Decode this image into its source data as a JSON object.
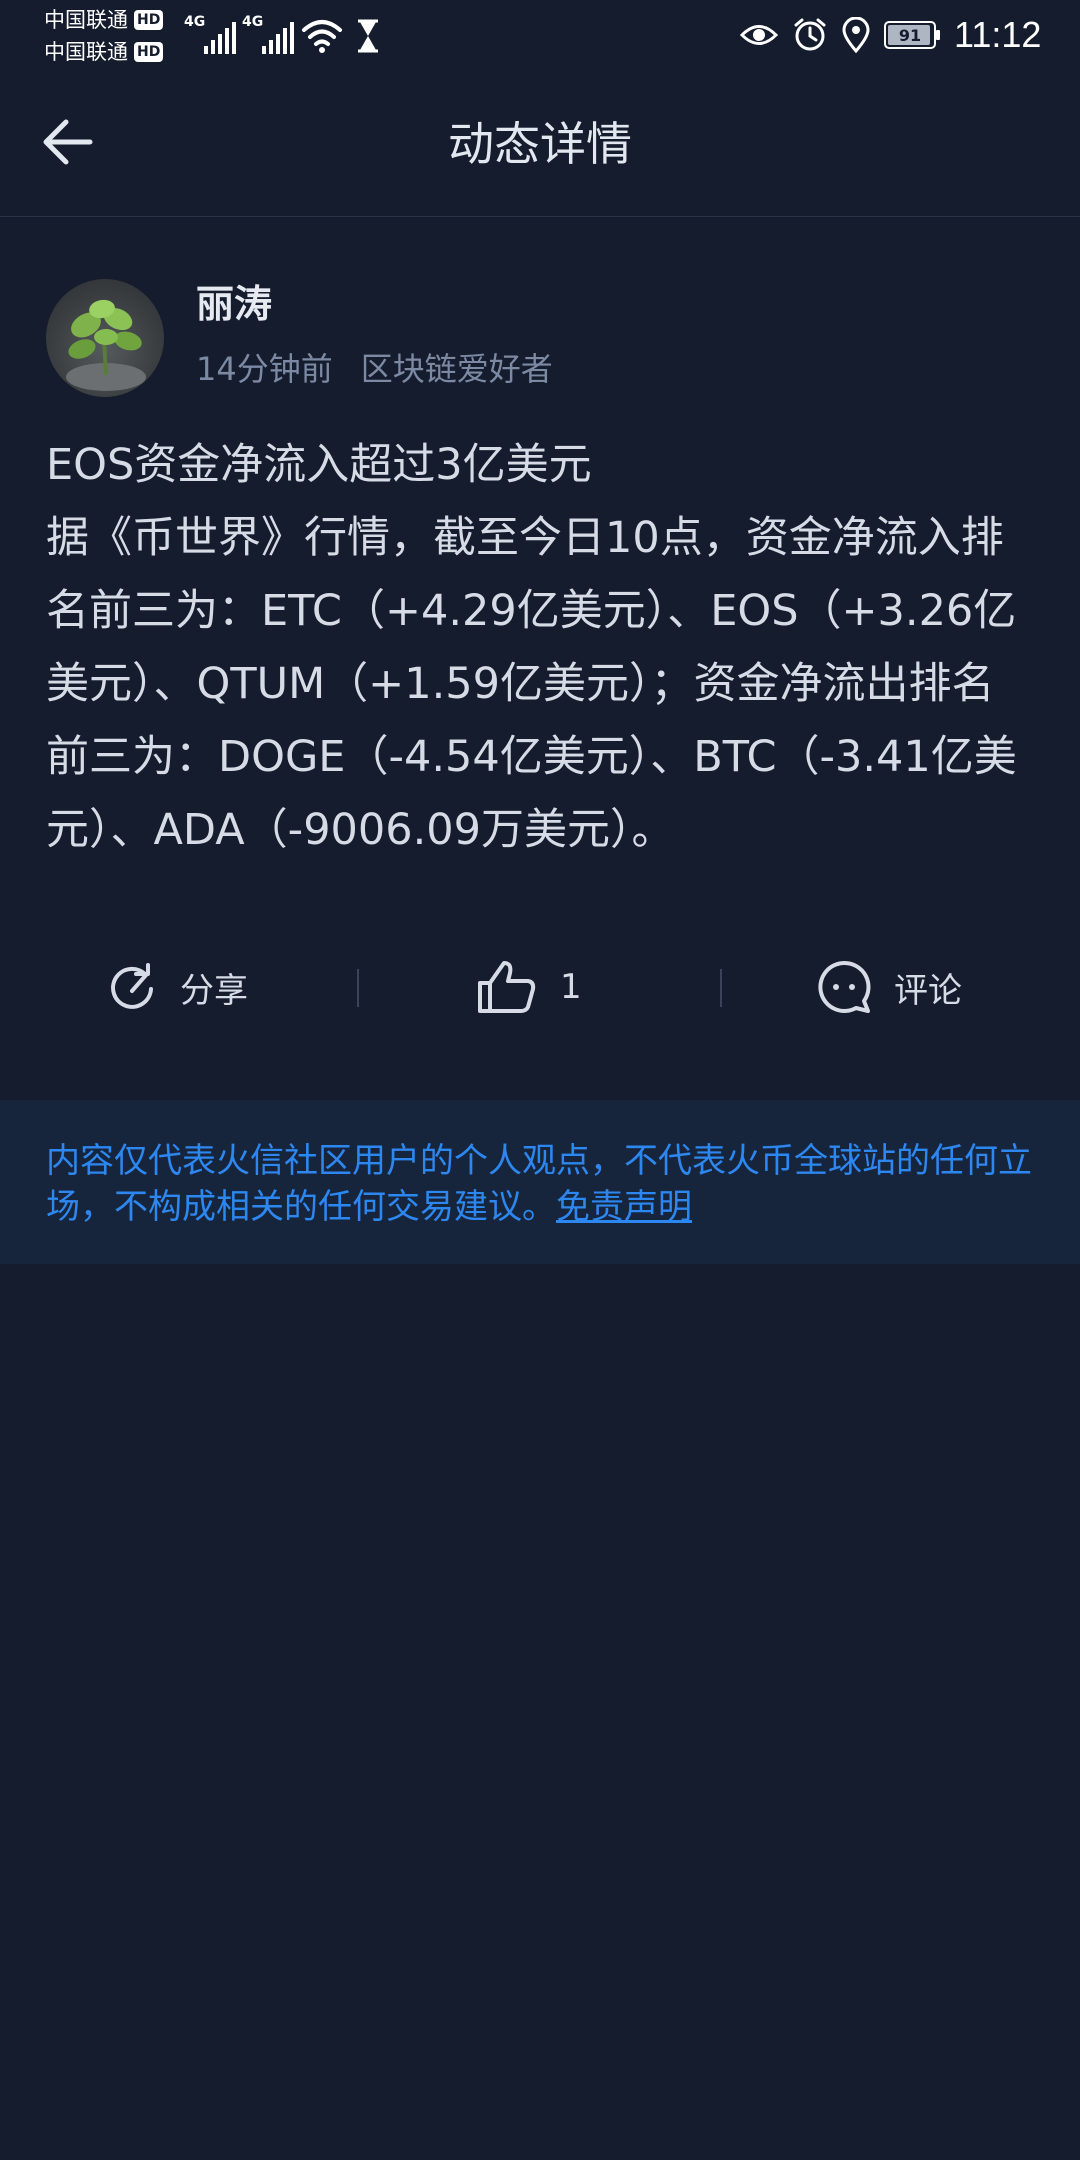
{
  "status_bar": {
    "carrier_1": "中国联通",
    "carrier_2": "中国联通",
    "hd_badge": "HD",
    "network_1": "4G",
    "network_2": "4G",
    "battery_level": "91",
    "time": "11:12"
  },
  "nav": {
    "title": "动态详情",
    "back_icon": "arrow-left-icon"
  },
  "post": {
    "author": "丽涛",
    "time_ago": "14分钟前",
    "tag": "区块链爱好者",
    "title": "EOS资金净流入超过3亿美元",
    "body": "据《币世界》行情，截至今日10点，资金净流入排名前三为：ETC（+4.29亿美元）、EOS（+3.26亿美元）、QTUM（+1.59亿美元）；资金净流出排名前三为：DOGE（-4.54亿美元）、BTC（-3.41亿美元）、ADA（-9006.09万美元）。"
  },
  "actions": {
    "share_label": "分享",
    "like_count": "1",
    "comment_label": "评论"
  },
  "disclaimer": {
    "text": "内容仅代表火信社区用户的个人观点，不代表火币全球站的任何立场，不构成相关的任何交易建议。",
    "link": "免责声明"
  },
  "colors": {
    "background": "#141c2d",
    "disclaimer_bg": "#17253c",
    "accent_blue": "#2d87f0",
    "meta_gray": "#7c89a3"
  }
}
